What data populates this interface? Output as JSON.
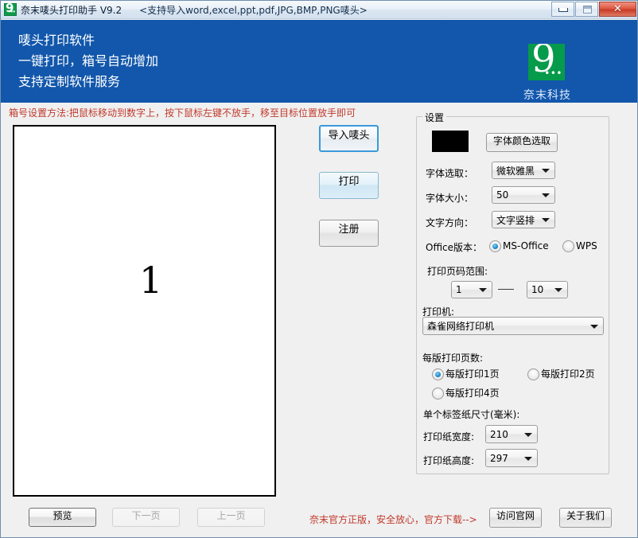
{
  "window": {
    "icon": "app-logo-icon",
    "title": "奈末唛头打印助手  V9.2",
    "subtitle": "<支持导入word,excel,ppt,pdf,JPG,BMP,PNG唛头>",
    "controls": {
      "minimize": "minimize-icon",
      "maximize": "maximize-icon",
      "close": "close-icon"
    }
  },
  "banner": {
    "line1": "唛头打印软件",
    "line2": "一键打印，箱号自动增加",
    "line3": "支持定制软件服务",
    "logo_glyph": "9",
    "logo_dots": "•••",
    "logo_caption": "奈末科技",
    "background_color": "#1257ab",
    "logo_color": "#069a4b"
  },
  "hint": {
    "text": "箱号设置方法:把鼠标移动到数字上，按下鼠标左键不放手，移至目标位置放手即可",
    "color": "#c0392b"
  },
  "canvas": {
    "box_number": "1",
    "background_color": "#ffffff",
    "border_color": "#000000"
  },
  "actions": {
    "import_label": "导入唛头",
    "print_label": "打印",
    "register_label": "注册"
  },
  "settings": {
    "group_title": "设置",
    "color_swatch": "#000000",
    "color_button_label": "字体颜色选取",
    "font_label": "字体选取：",
    "font_value": "微软雅黑",
    "size_label": "字体大小：",
    "size_value": "50",
    "direction_label": "文字方向：",
    "direction_value": "文字竖排",
    "office_label": "Office版本：",
    "office_options": [
      {
        "label": "MS-Office",
        "selected": true
      },
      {
        "label": "WPS",
        "selected": false
      }
    ],
    "page_range_label": "打印页码范围:",
    "page_from": "1",
    "page_separator": "—",
    "page_to": "10",
    "printer_label": "打印机:",
    "printer_value": "森雀网络打印机",
    "pages_per_sheet_label": "每版打印页数:",
    "pages_per_sheet_options": [
      {
        "label": "每版打印1页",
        "selected": true
      },
      {
        "label": "每版打印2页",
        "selected": false
      },
      {
        "label": "每版打印4页",
        "selected": false
      }
    ],
    "label_size_label": "单个标签纸尺寸(毫米):",
    "paper_width_label": "打印纸宽度:",
    "paper_width_value": "210",
    "paper_height_label": "打印纸高度:",
    "paper_height_value": "297"
  },
  "footer": {
    "preview_label": "预览",
    "next_label": "下一页",
    "prev_label": "上一页",
    "promo_text": "奈末官方正版，安全放心，官方下载-->",
    "promo_color": "#c0392b",
    "site_label": "访问官网",
    "about_label": "关于我们"
  }
}
